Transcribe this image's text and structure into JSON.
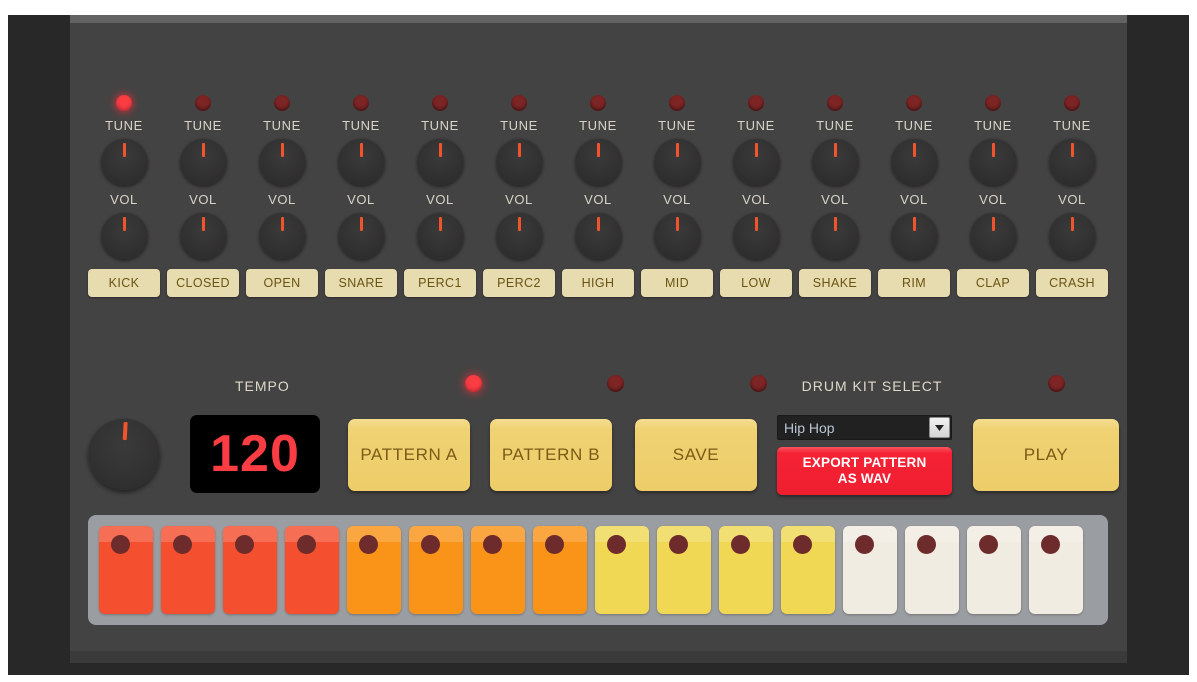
{
  "machine": {
    "panel_color": "#444343",
    "frame_color": "#282828",
    "accent_red": "#fa3c43",
    "accent_yellow": "#edcd68",
    "button_cream": "#e6dcaf"
  },
  "voices": [
    {
      "name": "KICK",
      "tune_label": "TUNE",
      "vol_label": "VOL",
      "led_on": true
    },
    {
      "name": "CLOSED",
      "tune_label": "TUNE",
      "vol_label": "VOL",
      "led_on": false
    },
    {
      "name": "OPEN",
      "tune_label": "TUNE",
      "vol_label": "VOL",
      "led_on": false
    },
    {
      "name": "SNARE",
      "tune_label": "TUNE",
      "vol_label": "VOL",
      "led_on": false
    },
    {
      "name": "PERC1",
      "tune_label": "TUNE",
      "vol_label": "VOL",
      "led_on": false
    },
    {
      "name": "PERC2",
      "tune_label": "TUNE",
      "vol_label": "VOL",
      "led_on": false
    },
    {
      "name": "HIGH",
      "tune_label": "TUNE",
      "vol_label": "VOL",
      "led_on": false
    },
    {
      "name": "MID",
      "tune_label": "TUNE",
      "vol_label": "VOL",
      "led_on": false
    },
    {
      "name": "LOW",
      "tune_label": "TUNE",
      "vol_label": "VOL",
      "led_on": false
    },
    {
      "name": "SHAKE",
      "tune_label": "TUNE",
      "vol_label": "VOL",
      "led_on": false
    },
    {
      "name": "RIM",
      "tune_label": "TUNE",
      "vol_label": "VOL",
      "led_on": false
    },
    {
      "name": "CLAP",
      "tune_label": "TUNE",
      "vol_label": "VOL",
      "led_on": false
    },
    {
      "name": "CRASH",
      "tune_label": "TUNE",
      "vol_label": "VOL",
      "led_on": false
    }
  ],
  "transport": {
    "tempo_label": "TEMPO",
    "tempo_value": "120",
    "pattern_a_label": "PATTERN A",
    "pattern_b_label": "PATTERN B",
    "save_label": "SAVE",
    "play_label": "PLAY",
    "pattern_a_led_on": true,
    "pattern_b_led_on": false,
    "save_led_on": false,
    "play_led_on": false
  },
  "drum_kit": {
    "label": "DRUM KIT SELECT",
    "selected": "Hip Hop",
    "options": [
      "Hip Hop"
    ],
    "arrow_icon": "chevron-down-icon",
    "export_line1": "EXPORT PATTERN",
    "export_line2": "AS WAV"
  },
  "sequencer": {
    "pads": [
      {
        "step": 1,
        "color": "#f4502f"
      },
      {
        "step": 2,
        "color": "#f4502f"
      },
      {
        "step": 3,
        "color": "#f4502f"
      },
      {
        "step": 4,
        "color": "#f4502f"
      },
      {
        "step": 5,
        "color": "#fa9418"
      },
      {
        "step": 6,
        "color": "#fa9418"
      },
      {
        "step": 7,
        "color": "#fa9418"
      },
      {
        "step": 8,
        "color": "#fa9418"
      },
      {
        "step": 9,
        "color": "#f0d855"
      },
      {
        "step": 10,
        "color": "#f0d855"
      },
      {
        "step": 11,
        "color": "#f0d855"
      },
      {
        "step": 12,
        "color": "#f0d855"
      },
      {
        "step": 13,
        "color": "#f1ece1"
      },
      {
        "step": 14,
        "color": "#f1ece1"
      },
      {
        "step": 15,
        "color": "#f1ece1"
      },
      {
        "step": 16,
        "color": "#f1ece1"
      }
    ]
  }
}
